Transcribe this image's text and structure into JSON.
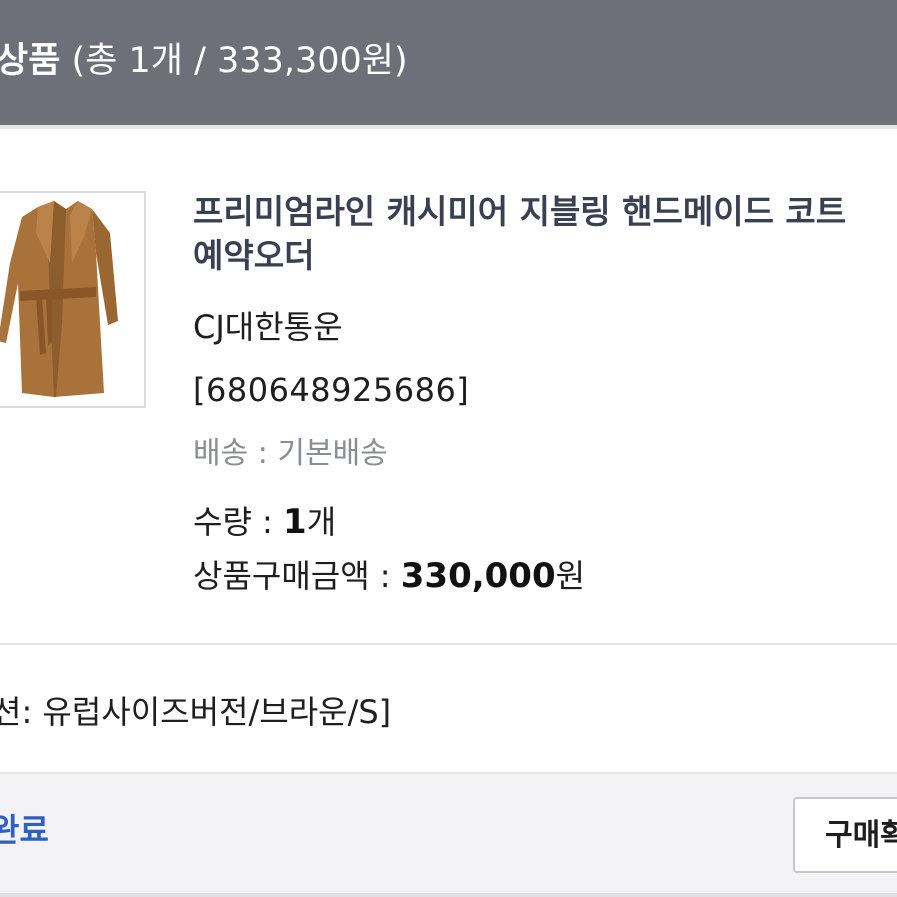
{
  "header": {
    "title": "상품",
    "summary": " (총 1개 / 333,300원)"
  },
  "product": {
    "image_icon": "coat-image",
    "title_line1": "프리미엄라인 캐시미어 지블링 핸드메이드 코트",
    "title_line2": "예약오더",
    "courier": "CJ대한통운",
    "tracking_number": "[680648925686]",
    "shipping": "배송 : 기본배송",
    "quantity_label": "수량 : ",
    "quantity_value": "1",
    "quantity_unit": "개",
    "amount_label": "상품구매금액 : ",
    "amount_value": "330,000",
    "amount_unit": "원"
  },
  "option": {
    "text": "션: 유럽사이즈버전/브라운/S]"
  },
  "footer": {
    "status": "완료",
    "confirm_button": "구매확정"
  },
  "colors": {
    "header_bg": "#6e7079",
    "title_text": "#3a3f52",
    "status_text": "#2f5fc4",
    "coat_brown": "#a8723a"
  }
}
